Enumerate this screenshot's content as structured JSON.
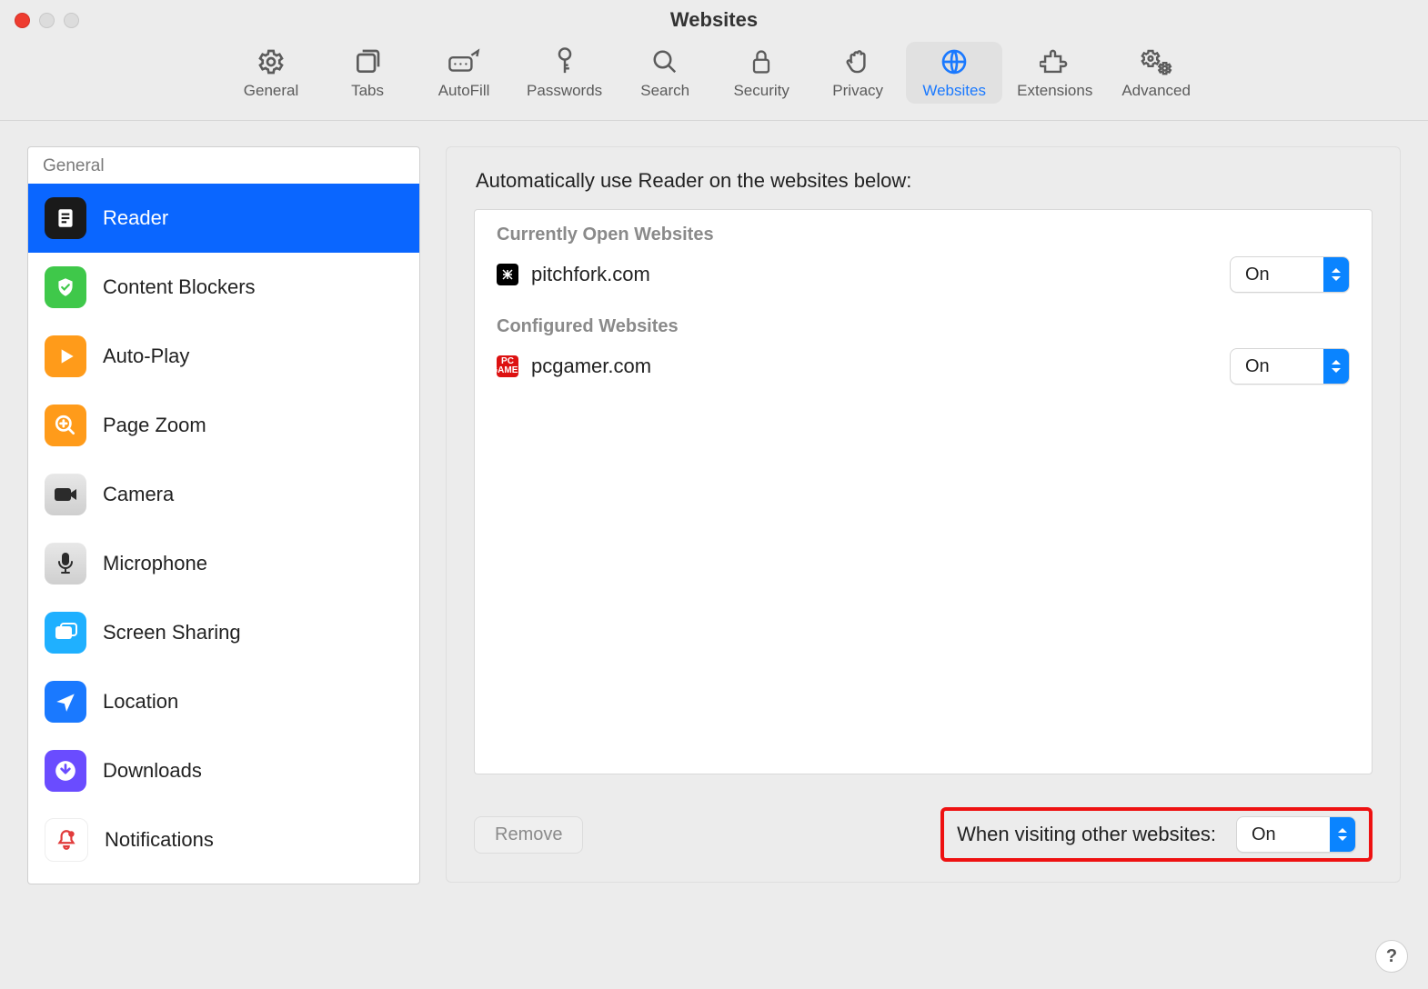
{
  "window": {
    "title": "Websites"
  },
  "toolbar": {
    "items": [
      {
        "id": "general",
        "label": "General"
      },
      {
        "id": "tabs",
        "label": "Tabs"
      },
      {
        "id": "autofill",
        "label": "AutoFill"
      },
      {
        "id": "passwords",
        "label": "Passwords"
      },
      {
        "id": "search",
        "label": "Search"
      },
      {
        "id": "security",
        "label": "Security"
      },
      {
        "id": "privacy",
        "label": "Privacy"
      },
      {
        "id": "websites",
        "label": "Websites"
      },
      {
        "id": "extensions",
        "label": "Extensions"
      },
      {
        "id": "advanced",
        "label": "Advanced"
      }
    ],
    "active": "websites"
  },
  "sidebar": {
    "header": "General",
    "items": [
      "Reader",
      "Content Blockers",
      "Auto-Play",
      "Page Zoom",
      "Camera",
      "Microphone",
      "Screen Sharing",
      "Location",
      "Downloads",
      "Notifications"
    ],
    "selected": 0
  },
  "main": {
    "intro": "Automatically use Reader on the websites below:",
    "section_open": "Currently Open Websites",
    "section_configured": "Configured Websites",
    "rows_open": [
      {
        "domain": "pitchfork.com",
        "value": "On"
      }
    ],
    "rows_configured": [
      {
        "domain": "pcgamer.com",
        "value": "On"
      }
    ],
    "remove_label": "Remove",
    "other_label": "When visiting other websites:",
    "other_value": "On"
  },
  "help": "?"
}
